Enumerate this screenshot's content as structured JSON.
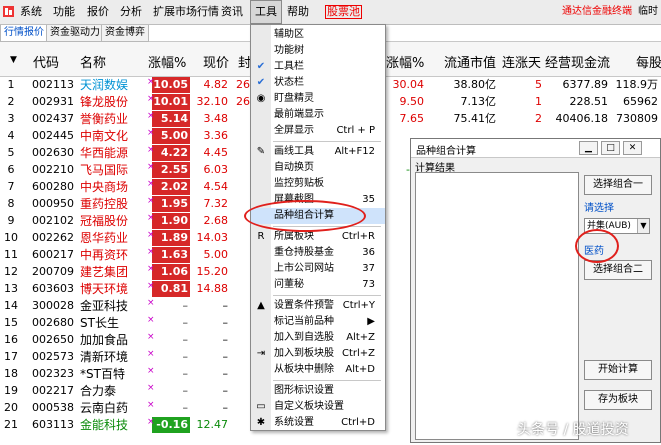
{
  "menubar": {
    "items": [
      "系统",
      "功能",
      "报价",
      "分析",
      "扩展市场行情",
      "资讯",
      "工具",
      "帮助"
    ],
    "stock_choose": "股票池",
    "right_text": "通达信金融终端",
    "right_text2": "临时"
  },
  "tabs": [
    "行情报价",
    "资金驱动力",
    "资金博弈"
  ],
  "columns": [
    "代码",
    "名称",
    "涨幅%",
    "现价",
    "封",
    "涨幅%",
    "流通市值",
    "连涨天",
    "经营现金流",
    "每股"
  ],
  "rows": [
    {
      "n": "1",
      "code": "002113",
      "name": "天润数娱",
      "chg": "10.05",
      "price": "4.82",
      "extra": "26",
      "c6": "30.04",
      "c7": "38.80亿",
      "c8": "5",
      "c9": "6377.89",
      "c10": "118.9万"
    },
    {
      "n": "2",
      "code": "002931",
      "name": "锋龙股份",
      "chg": "10.01",
      "price": "32.10",
      "extra": "26",
      "c6": "9.50",
      "c7": "7.13亿",
      "c8": "1",
      "c9": "228.51",
      "c10": "65962"
    },
    {
      "n": "3",
      "code": "002437",
      "name": "誉衡药业",
      "chg": "5.14",
      "price": "3.48",
      "extra": "",
      "c6": "7.65",
      "c7": "75.41亿",
      "c8": "2",
      "c9": "40406.18",
      "c10": "730809"
    },
    {
      "n": "4",
      "code": "002445",
      "name": "中南文化",
      "chg": "5.00",
      "price": "3.36",
      "extra": "",
      "c6": "",
      "c7": "",
      "c8": "",
      "c9": "",
      "c10": ""
    },
    {
      "n": "5",
      "code": "002630",
      "name": "华西能源",
      "chg": "4.22",
      "price": "4.45",
      "extra": "",
      "c6": "-3",
      "c7": "",
      "c8": "",
      "c9": "",
      "c10": ""
    },
    {
      "n": "6",
      "code": "002210",
      "name": "飞马国际",
      "chg": "2.55",
      "price": "6.03",
      "extra": "",
      "c6": "-17",
      "c7": "",
      "c8": "",
      "c9": "",
      "c10": ""
    },
    {
      "n": "7",
      "code": "600280",
      "name": "中央商场",
      "chg": "2.02",
      "price": "4.54",
      "extra": "",
      "c6": "-1",
      "c7": "",
      "c8": "",
      "c9": "",
      "c10": ""
    },
    {
      "n": "8",
      "code": "000950",
      "name": "重药控股",
      "chg": "1.95",
      "price": "7.32",
      "extra": "",
      "c6": "",
      "c7": "",
      "c8": "",
      "c9": "",
      "c10": ""
    },
    {
      "n": "9",
      "code": "002102",
      "name": "冠福股份",
      "chg": "1.90",
      "price": "2.68",
      "extra": "",
      "c6": "",
      "c7": "",
      "c8": "",
      "c9": "",
      "c10": ""
    },
    {
      "n": "10",
      "code": "002262",
      "name": "恩华药业",
      "chg": "1.89",
      "price": "14.03",
      "extra": "",
      "c6": "",
      "c7": "",
      "c8": "",
      "c9": "",
      "c10": ""
    },
    {
      "n": "11",
      "code": "600217",
      "name": "中再资环",
      "chg": "1.63",
      "price": "5.00",
      "extra": "",
      "c6": "",
      "c7": "",
      "c8": "",
      "c9": "",
      "c10": ""
    },
    {
      "n": "12",
      "code": "200709",
      "name": "建艺集团",
      "chg": "1.06",
      "price": "15.20",
      "extra": "",
      "c6": "",
      "c7": "",
      "c8": "",
      "c9": "",
      "c10": ""
    },
    {
      "n": "13",
      "code": "603603",
      "name": "博天环境",
      "chg": "0.81",
      "price": "14.88",
      "extra": "",
      "c6": "-1",
      "c7": "",
      "c8": "",
      "c9": "",
      "c10": ""
    },
    {
      "n": "14",
      "code": "300028",
      "name": "金亚科技",
      "chg": "–",
      "price": "–",
      "extra": "",
      "c6": "",
      "c7": "",
      "c8": "",
      "c9": "",
      "c10": ""
    },
    {
      "n": "15",
      "code": "002680",
      "name": "ST长生",
      "chg": "–",
      "price": "–",
      "extra": "",
      "c6": "",
      "c7": "",
      "c8": "",
      "c9": "",
      "c10": ""
    },
    {
      "n": "16",
      "code": "002650",
      "name": "加加食品",
      "chg": "–",
      "price": "–",
      "extra": "",
      "c6": "-1",
      "c7": "",
      "c8": "",
      "c9": "",
      "c10": ""
    },
    {
      "n": "17",
      "code": "002573",
      "name": "清新环境",
      "chg": "–",
      "price": "–",
      "extra": "",
      "c6": "",
      "c7": "",
      "c8": "",
      "c9": "",
      "c10": ""
    },
    {
      "n": "18",
      "code": "002323",
      "name": "*ST百特",
      "chg": "–",
      "price": "–",
      "extra": "",
      "c6": "",
      "c7": "",
      "c8": "",
      "c9": "",
      "c10": ""
    },
    {
      "n": "19",
      "code": "002217",
      "name": "合力泰",
      "chg": "–",
      "price": "–",
      "extra": "",
      "c6": "-1",
      "c7": "",
      "c8": "",
      "c9": "",
      "c10": ""
    },
    {
      "n": "20",
      "code": "000538",
      "name": "云南白药",
      "chg": "–",
      "price": "–",
      "extra": "",
      "c6": "-3",
      "c7": "",
      "c8": "",
      "c9": "",
      "c10": ""
    },
    {
      "n": "21",
      "code": "603113",
      "name": "金能科技",
      "chg": "-0.16",
      "price": "12.47",
      "extra": "",
      "c6": "-1",
      "c7": "",
      "c8": "",
      "c9": "",
      "c10": ""
    }
  ],
  "dropdown": [
    {
      "label": "辅助区",
      "sc": "",
      "icon": "",
      "type": "item"
    },
    {
      "label": "功能树",
      "sc": "",
      "icon": "",
      "type": "item"
    },
    {
      "label": "工具栏",
      "sc": "",
      "icon": "✔",
      "type": "item"
    },
    {
      "label": "状态栏",
      "sc": "",
      "icon": "✔",
      "type": "item"
    },
    {
      "label": "盯盘精灵",
      "sc": "",
      "icon": "◉",
      "type": "item"
    },
    {
      "label": "最前端显示",
      "sc": "",
      "icon": "",
      "type": "item"
    },
    {
      "label": "全屏显示",
      "sc": "Ctrl + P",
      "icon": "",
      "type": "item"
    },
    {
      "type": "sep"
    },
    {
      "label": "画线工具",
      "sc": "Alt+F12",
      "icon": "✎",
      "type": "item"
    },
    {
      "label": "自动换页",
      "sc": "",
      "icon": "",
      "type": "item"
    },
    {
      "label": "监控剪贴板",
      "sc": "",
      "icon": "",
      "type": "item"
    },
    {
      "label": "屏幕截图",
      "sc": "35",
      "icon": "",
      "type": "item"
    },
    {
      "label": "品种组合计算",
      "sc": "",
      "icon": "",
      "type": "item",
      "hl": true
    },
    {
      "type": "sep"
    },
    {
      "label": "所属板块",
      "sc": "Ctrl+R",
      "icon": "R",
      "type": "item"
    },
    {
      "label": "重仓持股基金",
      "sc": "36",
      "icon": "",
      "type": "item"
    },
    {
      "label": "上市公司网站",
      "sc": "37",
      "icon": "",
      "type": "item"
    },
    {
      "label": "问董秘",
      "sc": "73",
      "icon": "",
      "type": "item"
    },
    {
      "type": "sep"
    },
    {
      "label": "设置条件预警",
      "sc": "Ctrl+Y",
      "icon": "▲",
      "type": "item"
    },
    {
      "label": "标记当前品种",
      "sc": "▶",
      "icon": "",
      "type": "item"
    },
    {
      "label": "加入到自选股",
      "sc": "Alt+Z",
      "icon": "",
      "type": "item"
    },
    {
      "label": "加入到板块股",
      "sc": "Ctrl+Z",
      "icon": "⇥",
      "type": "item"
    },
    {
      "label": "从板块中删除",
      "sc": "Alt+D",
      "icon": "",
      "type": "item"
    },
    {
      "type": "sep"
    },
    {
      "label": "图形标识设置",
      "sc": "",
      "icon": "",
      "type": "item"
    },
    {
      "label": "自定义板块设置",
      "sc": "",
      "icon": "▭",
      "type": "item"
    },
    {
      "label": "系统设置",
      "sc": "Ctrl+D",
      "icon": "✱",
      "type": "item"
    }
  ],
  "panel": {
    "title": "品种组合计算",
    "label": "计算结果",
    "btn_select1": "选择组合一",
    "link_select": "请选择",
    "set_value": "并集(AUB)",
    "link_medicine": "医药",
    "btn_select2": "选择组合二",
    "btn_start": "开始计算",
    "btn_save": "存为板块"
  },
  "watermark": "头条号 / 股道投资"
}
